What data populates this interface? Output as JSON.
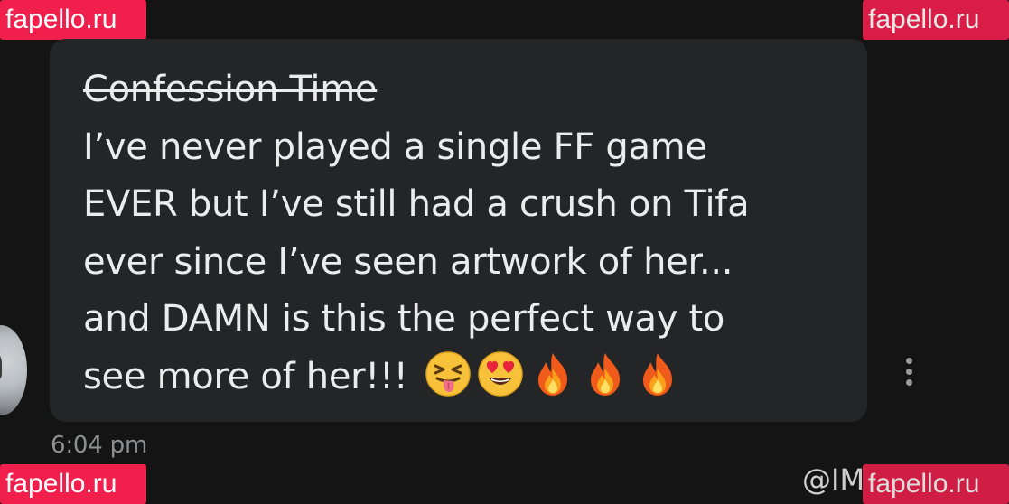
{
  "watermark": {
    "top_left": "fapello.ru",
    "top_right": "fapello.ru",
    "bottom_left": "fapello.ru",
    "bottom_right": "fapello.ru"
  },
  "message": {
    "title_struck": "Confession Time",
    "lines": [
      "I’ve never played a single FF game",
      "EVER but I’ve still had a crush on Tifa",
      "ever since I’ve seen artwork of her...",
      "and DAMN is this the perfect way to",
      "see more of her!!!"
    ],
    "emojis": [
      "squinting-tongue-emoji",
      "heart-eyes-emoji",
      "fire-emoji",
      "fire-emoji",
      "fire-emoji"
    ]
  },
  "timestamp": "6:04 pm",
  "handle": "@IM",
  "colors": {
    "background": "#141414",
    "bubble": "#232526",
    "text": "#ececec",
    "muted": "#8d8f90",
    "watermark": "#f01f4c"
  }
}
